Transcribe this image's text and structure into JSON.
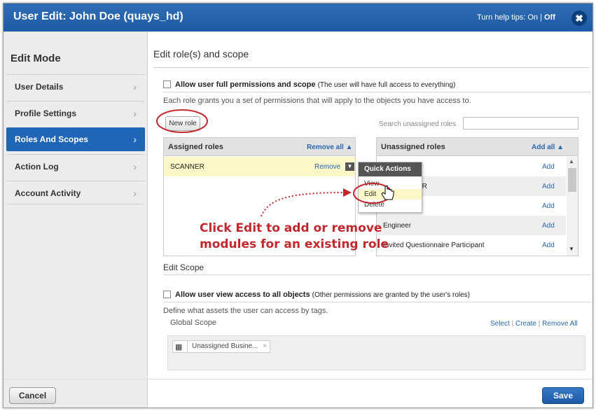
{
  "window": {
    "title": "User Edit: John Doe (quays_hd)",
    "help_prefix": "Turn help tips: On | ",
    "help_off": "Off",
    "close_icon": "close-icon"
  },
  "sidebar": {
    "heading": "Edit Mode",
    "items": [
      {
        "label": "User Details"
      },
      {
        "label": "Profile Settings"
      },
      {
        "label": "Roles And Scopes",
        "active": true
      },
      {
        "label": "Action Log"
      },
      {
        "label": "Account Activity"
      }
    ]
  },
  "roles": {
    "heading": "Edit role(s) and scope",
    "full_perm_label": "Allow user full permissions and scope",
    "full_perm_note": "(The user will have full access to everything)",
    "info": "Each role grants you a set of permissions that will apply to the objects you have access to.",
    "new_role_label": "New role",
    "search_label": "Search unassigned roles",
    "search_value": "",
    "assigned_header": "Assigned roles",
    "remove_all_label": "Remove all",
    "assigned": [
      {
        "name": "SCANNER",
        "action": "Remove"
      }
    ],
    "unassigned_header": "Unassigned roles",
    "add_all_label": "Add all",
    "unassigned": [
      {
        "name": "",
        "action": "Add"
      },
      {
        "name": "ER",
        "action": "Add"
      },
      {
        "name": "",
        "action": "Add"
      },
      {
        "name": "Engineer",
        "action": "Add"
      },
      {
        "name": "Invited Questionnaire Participant",
        "action": "Add"
      }
    ]
  },
  "quick_actions": {
    "header": "Quick Actions",
    "items": [
      "View",
      "Edit",
      "Delete"
    ]
  },
  "callout": {
    "line1": "Click Edit to add or remove",
    "line2": "modules for an existing role"
  },
  "scope": {
    "heading": "Edit Scope",
    "view_all_label": "Allow user view access to all objects",
    "view_all_note": "(Other permissions are granted by the user's roles)",
    "info": "Define what assets the user can access by tags.",
    "global_scope_label": "Global Scope",
    "select_label": "Select",
    "create_label": "Create",
    "remove_all_label": "Remove All",
    "tag_label": "Unassigned Busine...",
    "tag_icon": "grid-icon"
  },
  "footer": {
    "cancel_label": "Cancel",
    "save_label": "Save"
  },
  "colors": {
    "title_bar": "#1e5aa3",
    "active_nav": "#1f66b8",
    "callout": "#c1272d",
    "link": "#2a66b0"
  }
}
